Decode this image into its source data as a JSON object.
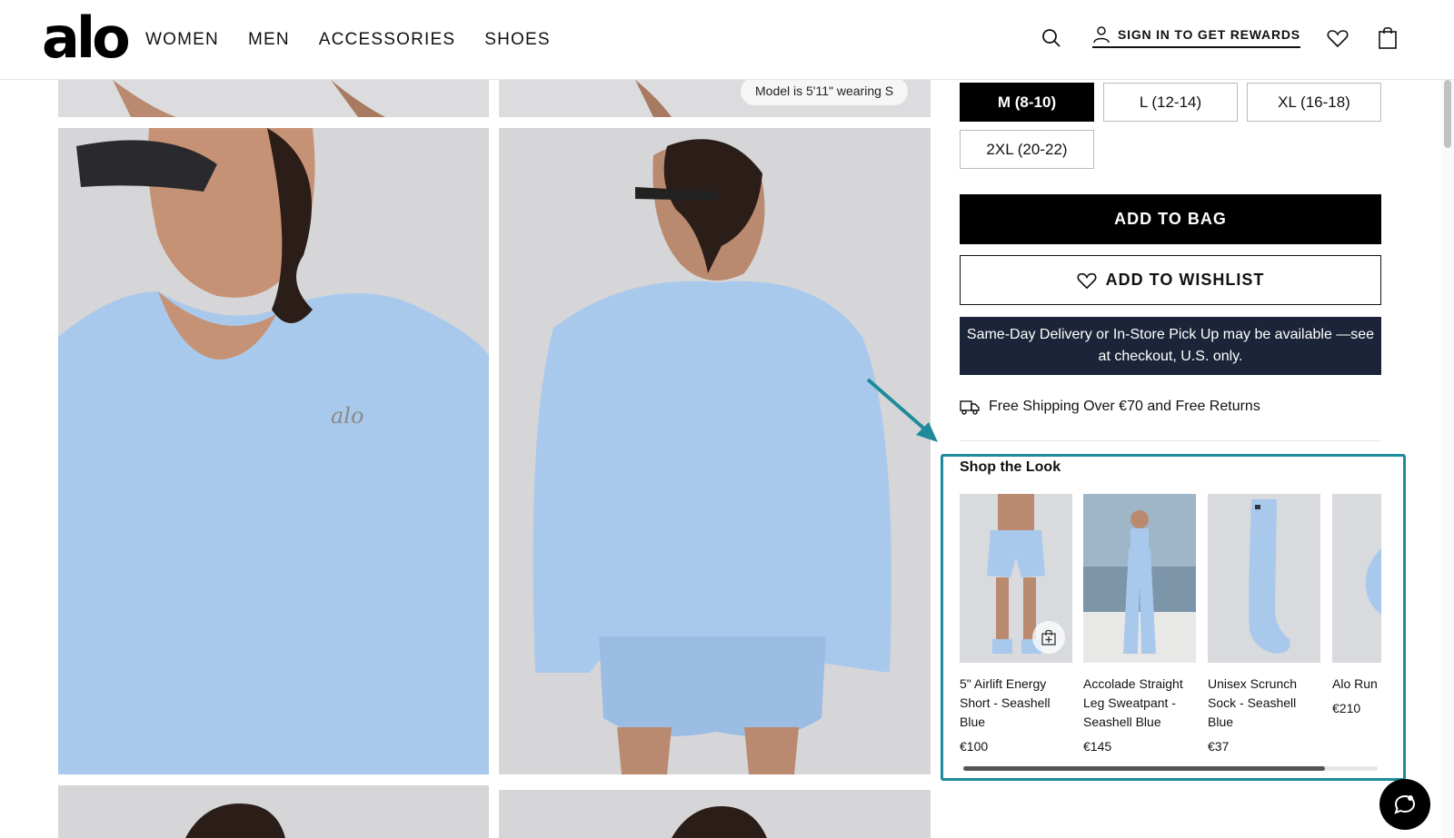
{
  "header": {
    "logo": "alo",
    "nav": [
      "WOMEN",
      "MEN",
      "ACCESSORIES",
      "SHOES"
    ],
    "signin_label": "SIGN IN TO GET REWARDS"
  },
  "gallery": {
    "model_tag": "Model is 5'11\" wearing S"
  },
  "sizes": [
    {
      "label": "M (8-10)",
      "selected": true
    },
    {
      "label": "L (12-14)",
      "selected": false
    },
    {
      "label": "XL (16-18)",
      "selected": false
    },
    {
      "label": "2XL (20-22)",
      "selected": false
    }
  ],
  "actions": {
    "add_to_bag": "ADD TO BAG",
    "add_to_wishlist": "ADD TO WISHLIST"
  },
  "delivery_notice": "Same-Day Delivery or In-Store Pick Up may be available —see at checkout, U.S. only.",
  "shipping_text": "Free Shipping Over €70 and Free Returns",
  "shop_the_look": {
    "title": "Shop the Look",
    "items": [
      {
        "name": "5\" Airlift Energy Short - Seashell Blue",
        "price": "€100"
      },
      {
        "name": "Accolade Straight Leg Sweatpant - Seashell Blue",
        "price": "€145"
      },
      {
        "name": "Unisex Scrunch Sock - Seashell Blue",
        "price": "€37"
      },
      {
        "name": "Alo Run Seashel",
        "price": "€210"
      }
    ]
  },
  "colors": {
    "accent_highlight": "#1e8b9b",
    "delivery_bg": "#1b2438",
    "product_blue": "#a9c9ec"
  }
}
